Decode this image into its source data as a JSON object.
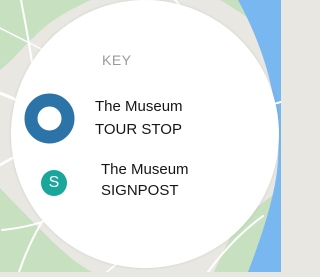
{
  "key_title": "KEY",
  "legend": [
    {
      "line1": "The Museum",
      "line2": "TOUR STOP",
      "icon": "tour-stop-ring-icon",
      "color": "#2c73a8"
    },
    {
      "line1": "The Museum",
      "line2": "SIGNPOST",
      "icon": "signpost-s-icon",
      "symbol_text": "S",
      "color": "#18a79a"
    }
  ],
  "colors": {
    "map_land": "#e9e7e2",
    "map_park": "#c7e1c0",
    "map_water": "#78b7f0",
    "map_roads": "#ffffff"
  }
}
